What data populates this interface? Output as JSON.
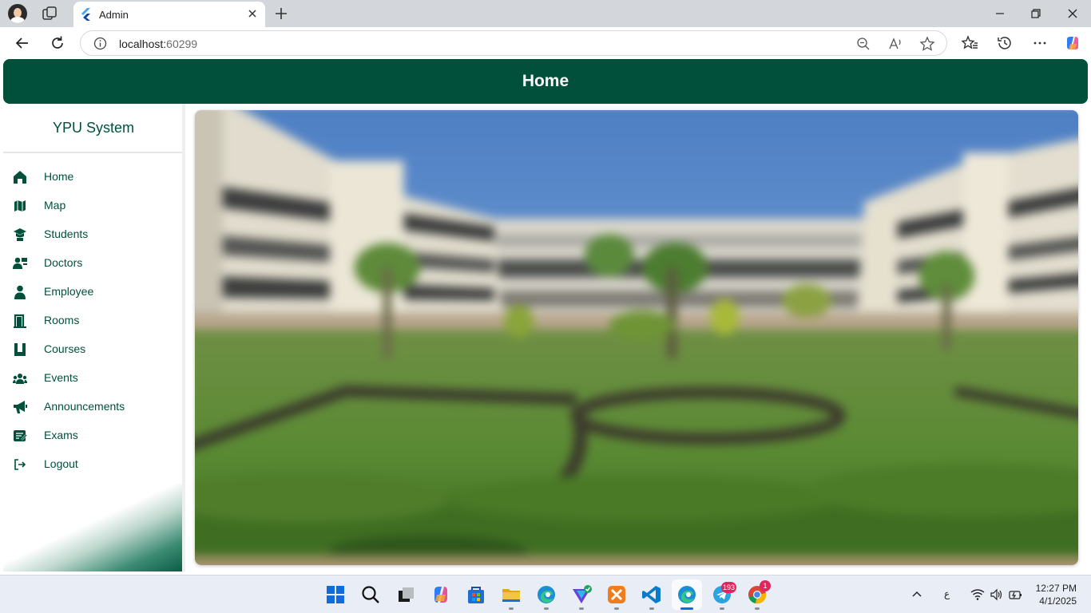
{
  "browser": {
    "tab_title": "Admin",
    "url_host": "localhost:",
    "url_port": "60299"
  },
  "page": {
    "title": "Home",
    "hero_image": "campus-courtyard-photo"
  },
  "sidebar": {
    "brand": "YPU System",
    "items": [
      {
        "label": "Home",
        "icon": "home-icon"
      },
      {
        "label": "Map",
        "icon": "map-icon"
      },
      {
        "label": "Students",
        "icon": "graduation-cap-icon"
      },
      {
        "label": "Doctors",
        "icon": "doctors-icon"
      },
      {
        "label": "Employee",
        "icon": "person-icon"
      },
      {
        "label": "Rooms",
        "icon": "door-icon"
      },
      {
        "label": "Courses",
        "icon": "book-icon"
      },
      {
        "label": "Events",
        "icon": "group-icon"
      },
      {
        "label": "Announcements",
        "icon": "megaphone-icon"
      },
      {
        "label": "Exams",
        "icon": "exam-icon"
      },
      {
        "label": "Logout",
        "icon": "logout-icon"
      }
    ]
  },
  "taskbar": {
    "telegram_badge": "193",
    "chrome_badge": "1",
    "language": "ع",
    "time": "12:27 PM",
    "date": "4/1/2025"
  },
  "colors": {
    "primary": "#00503c",
    "sidebar_text": "#00503c"
  }
}
